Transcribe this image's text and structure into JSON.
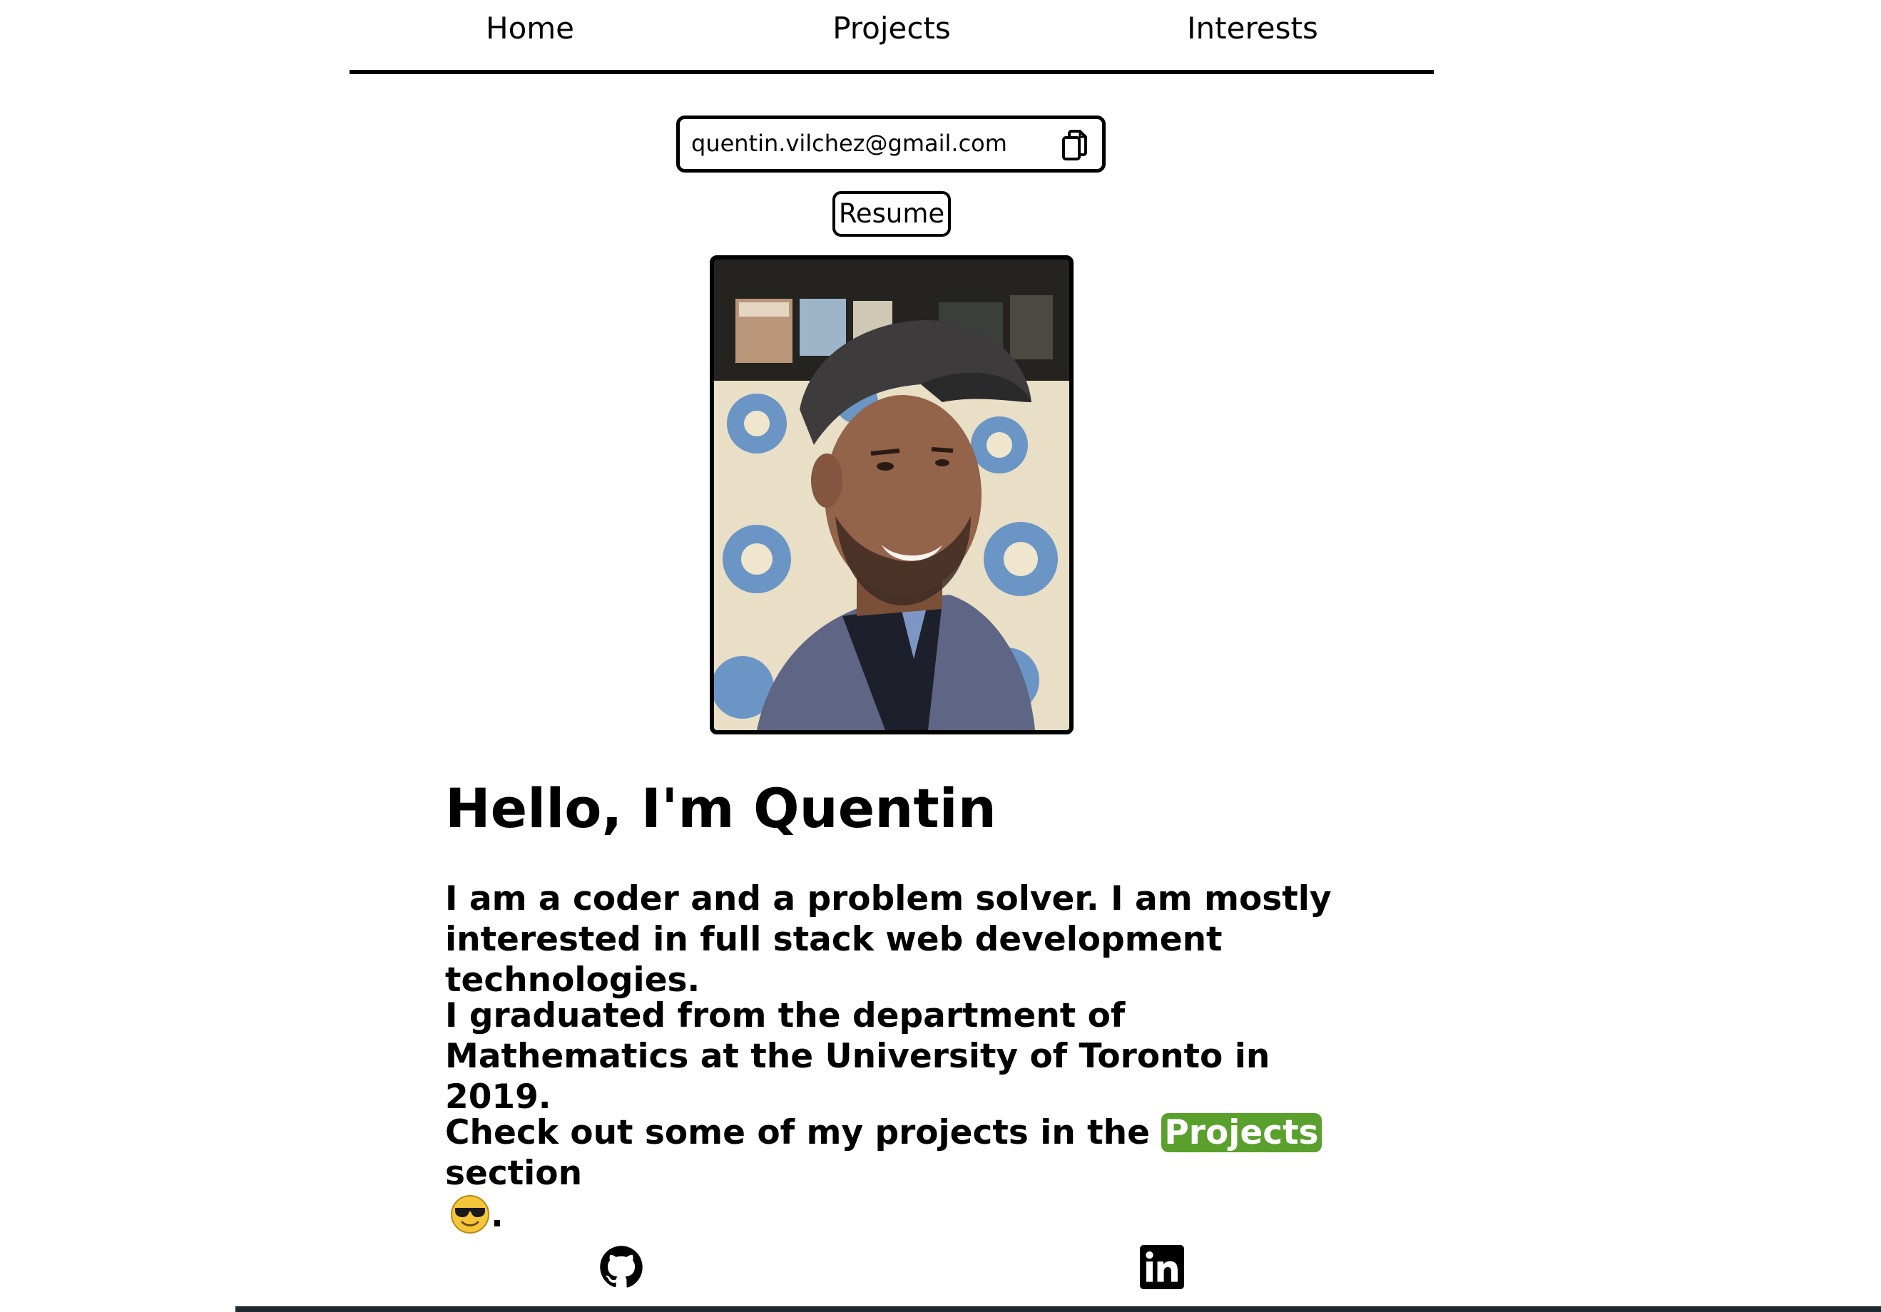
{
  "nav": {
    "items": [
      {
        "label": "Home"
      },
      {
        "label": "Projects"
      },
      {
        "label": "Interests"
      }
    ]
  },
  "contact": {
    "email": "quentin.vilchez@gmail.com",
    "copy_icon": "copy-icon",
    "resume_label": "Resume"
  },
  "intro": {
    "heading": "Hello, I'm Quentin",
    "p1": "I am a coder and a problem solver. I am mostly interested in full stack web development technologies.",
    "p2": "I graduated from the department of Mathematics at the University of Toronto in 2019.",
    "p3_before": "Check out some of my projects in the ",
    "p3_link": "Projects",
    "p3_after": " section",
    "p3_end": ".",
    "emoji_icon": "sunglasses-emoji-icon"
  },
  "social": {
    "github_icon": "github-icon",
    "linkedin_icon": "linkedin-icon"
  },
  "colors": {
    "accent_green": "#5aa02c",
    "text": "#000000",
    "background": "#ffffff"
  }
}
